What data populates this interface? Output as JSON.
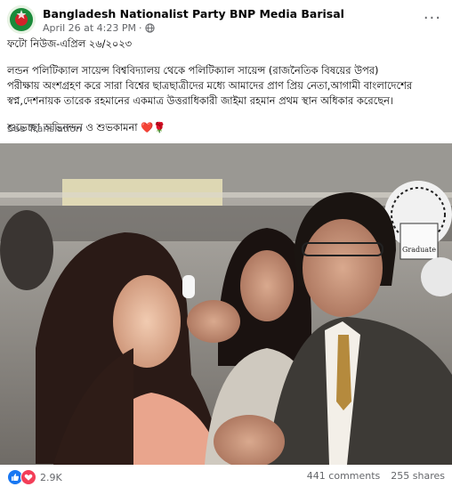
{
  "post": {
    "author": "Bangladesh Nationalist Party BNP Media Barisal",
    "timestamp": "April 26 at 4:23 PM",
    "privacy_icon": "globe-icon",
    "more_label": "···",
    "text_lines": [
      "ফটো নিউজ-এপ্রিল ২৬/২০২৩",
      "লন্ডন পলিটিক্যাল সায়েন্স বিশ্ববিদ্যালয় থেকে  পলিটিক্যাল সায়েন্স (রাজনৈতিক বিষয়ের উপর)",
      "পরীক্ষায় অংশগ্রহণ করে সারা বিশ্বের ছাত্রছাত্রীদের মধ্যে আমাদের প্রাণ প্রিয় নেতা,আগামী বাংলাদেশের",
      "স্বপ্ন,দেশনায়ক তারেক রহমানের একমাত্র উত্তরাধিকারী জাইমা রহমান প্রথম স্থান অধিকার করেছেন।",
      "শুভেচ্ছা অভিনন্দন ও শুভকামনা"
    ],
    "emoji_label": "❤️🌹",
    "see_translation": "See Translation"
  },
  "photo": {
    "description_icon": "photo-image",
    "sign_text": "Graduate"
  },
  "footer": {
    "reaction_count": "2.9K",
    "comments": "441 comments",
    "shares": "255 shares"
  }
}
